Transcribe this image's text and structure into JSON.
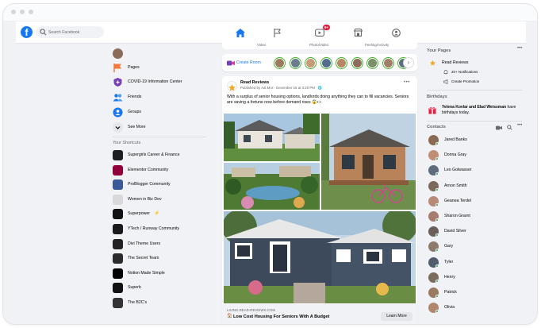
{
  "topbar": {
    "logo_letter": "f",
    "search_placeholder": "Search Facebook",
    "watch_badge": "9+",
    "tabs": [
      {
        "name": "home",
        "active": true
      },
      {
        "name": "pages",
        "active": false
      },
      {
        "name": "watch",
        "active": false
      },
      {
        "name": "marketplace",
        "active": false
      },
      {
        "name": "groups",
        "active": false
      }
    ]
  },
  "stories_strip": {
    "items": [
      "Video",
      "Photo/Video",
      "Feeling/Activity"
    ]
  },
  "left_sidebar": {
    "items": [
      {
        "label": "Pages",
        "icon": "flag-icon",
        "color": "#f5793b"
      },
      {
        "label": "COVID-19 Information Center",
        "icon": "covid-icon",
        "color": "#7b3fb5"
      },
      {
        "label": "Friends",
        "icon": "friends-icon",
        "color": "#1877f2"
      },
      {
        "label": "Groups",
        "icon": "groups-icon",
        "color": "#1877f2"
      },
      {
        "label": "See More",
        "icon": "chevron-down-icon",
        "color": "#e4e6eb"
      }
    ],
    "shortcuts_heading": "Your Shortcuts",
    "shortcuts": [
      {
        "label": "Supergirls Career & Finance",
        "color": "#1c1e21"
      },
      {
        "label": "Elementor Community",
        "color": "#92003b"
      },
      {
        "label": "ProBlogger Community",
        "color": "#3b5998"
      },
      {
        "label": "Women in Biz Dev",
        "color": "#d9d9d9"
      },
      {
        "label": "Superpower",
        "color": "#111111",
        "emoji": "⚡"
      },
      {
        "label": "YTech / Runway Community",
        "color": "#1a1a1a"
      },
      {
        "label": "Divi Theme Users",
        "color": "#222222"
      },
      {
        "label": "The Secret Team",
        "color": "#2b2b2b"
      },
      {
        "label": "Notion Made Simple",
        "color": "#000000"
      },
      {
        "label": "Superb",
        "color": "#111111"
      },
      {
        "label": "The B2C's",
        "color": "#333333"
      }
    ]
  },
  "rooms": {
    "create_room_label": "Create Room",
    "avatar_colors": [
      "#9c7b61",
      "#6b7c8d",
      "#c79a7a",
      "#556b8e",
      "#b58766",
      "#8e6b5a",
      "#7d8e6a",
      "#a37d6a",
      "#5e6d7b"
    ]
  },
  "post": {
    "author": "Read Reviews",
    "meta": "Published by Adi Mor · December 15 at 3:20 PM · 🌐",
    "text": "With a surplus of senior housing options, landlords doing anything they can to fill vacancies. Seniors are saving a fortune now before demand rises 😱👀",
    "link_domain": "LIVING.READ-REVIEWS.COM",
    "link_title": "Low Cost Housing For Seniors With A Budget",
    "link_emoji": "🏠",
    "cta": "Learn More"
  },
  "right_sidebar": {
    "pages_heading": "Your Pages",
    "page_name": "Read Reviews",
    "notifications": "20+ Notifications",
    "create_promotion": "Create Promotion",
    "birthdays_heading": "Birthdays",
    "birthday_names": "Yelena Kovlar and Elad Weissman",
    "birthday_suffix": " have birthdays today.",
    "contacts_heading": "Contacts",
    "contacts": [
      {
        "name": "Jared Banks",
        "color": "#8a6a55"
      },
      {
        "name": "Donna Gray",
        "color": "#c08e74"
      },
      {
        "name": "Leo Golwasser",
        "color": "#5d6b7c"
      },
      {
        "name": "Arnon Smith",
        "color": "#7c6a5b"
      },
      {
        "name": "Geanea Terdel",
        "color": "#b78a78"
      },
      {
        "name": "Sharon Grarnt",
        "color": "#a67c70"
      },
      {
        "name": "David Silver",
        "color": "#6b6058"
      },
      {
        "name": "Gary",
        "color": "#8d7a6a"
      },
      {
        "name": "Tyler",
        "color": "#4f5d6e"
      },
      {
        "name": "Henry",
        "color": "#7a6b5c"
      },
      {
        "name": "Patrick",
        "color": "#9a7b62"
      },
      {
        "name": "Olivia",
        "color": "#b0866c"
      }
    ]
  }
}
